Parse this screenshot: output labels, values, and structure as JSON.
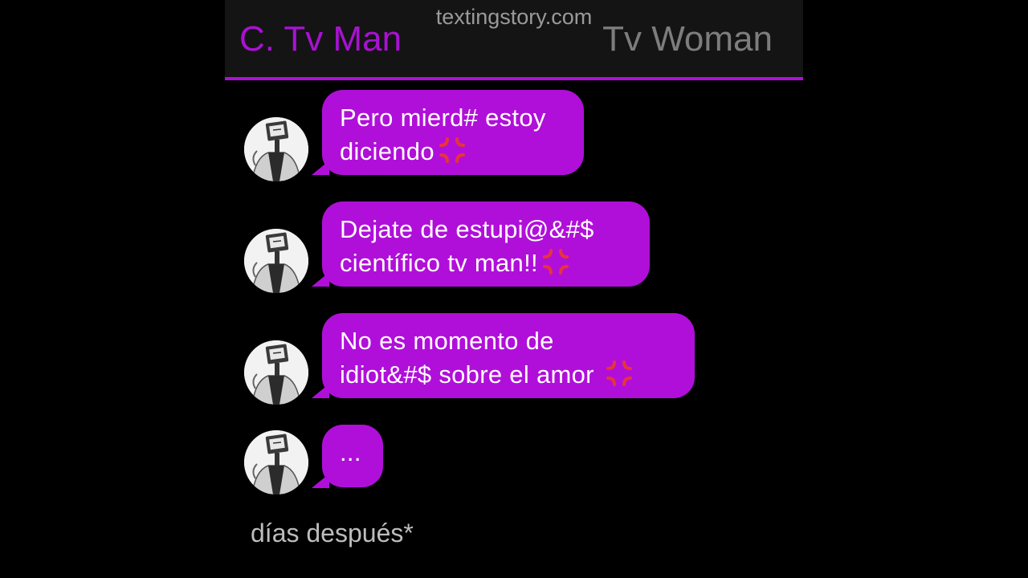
{
  "header": {
    "watermark": "textingstory.com",
    "contact_left": "C. Tv Man",
    "contact_right": "Tv Woman"
  },
  "messages": [
    {
      "line1": "Pero mierd# estoy",
      "line2": "diciendo",
      "emoji": "anger-symbol-icon"
    },
    {
      "line1": "Dejate de estupi@&#$",
      "line2": "científico tv man!!",
      "emoji": "anger-symbol-icon"
    },
    {
      "line1": "No es momento de",
      "line2": "idiot&#$ sobre el amor ",
      "emoji": "anger-symbol-icon"
    },
    {
      "line1": "...",
      "line2": "",
      "emoji": ""
    }
  ],
  "footer": {
    "caption": "días después*"
  },
  "colors": {
    "bubble": "#b00fd9",
    "accent_line": "#b00fd9",
    "left_name": "#a911d3",
    "right_name": "#7d7d7d",
    "background": "#000000"
  }
}
